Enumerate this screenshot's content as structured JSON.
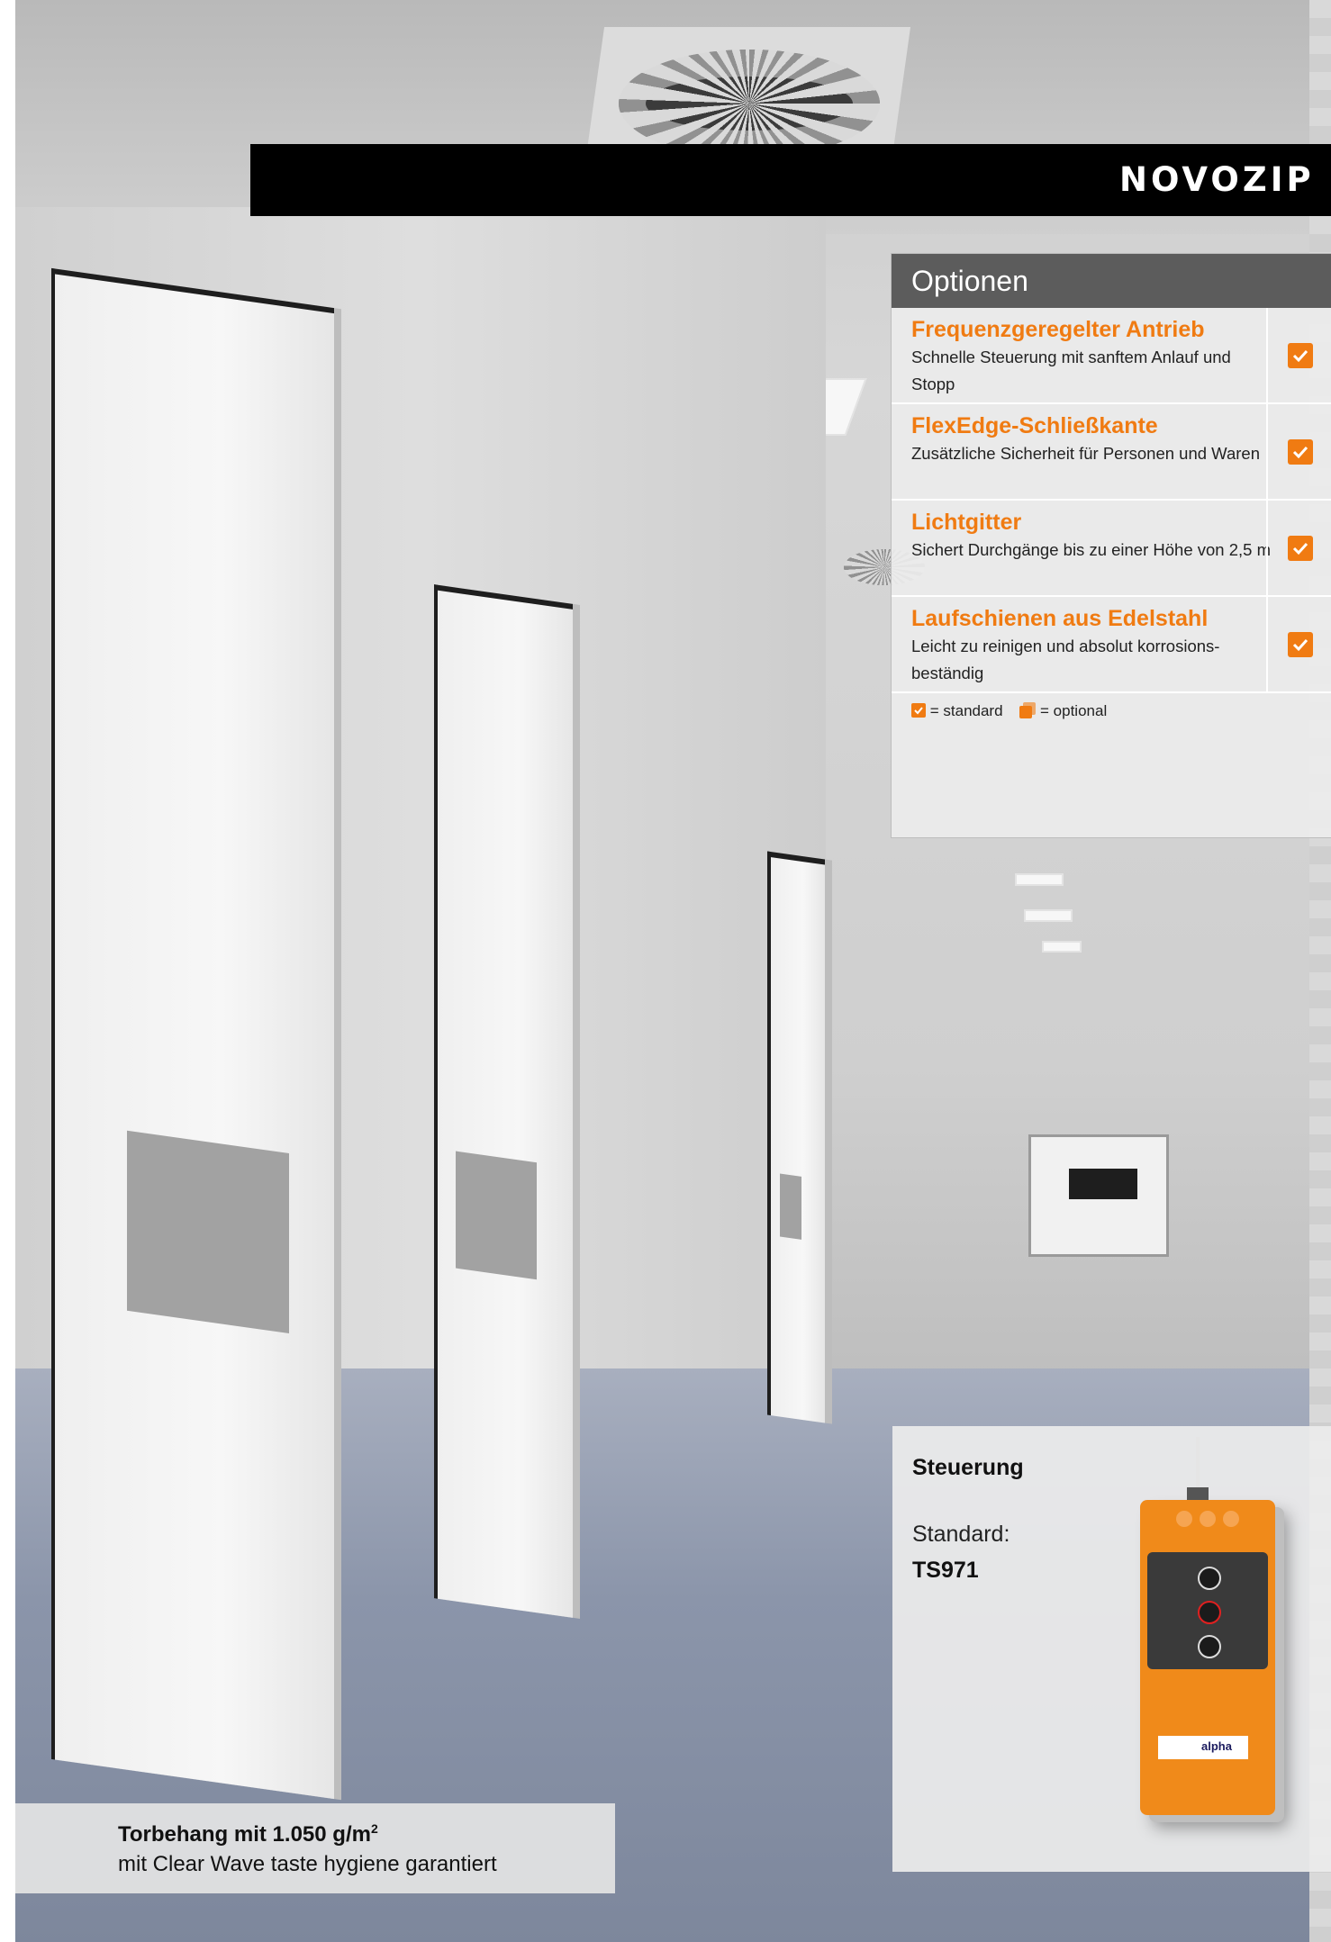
{
  "header": {
    "title": "NOVOZIP"
  },
  "options": {
    "heading": "Optionen",
    "items": [
      {
        "title": "Frequenzgeregelter Antrieb",
        "description": "Schnelle Steuerung mit sanftem Anlauf und Stopp",
        "status": "standard"
      },
      {
        "title": "FlexEdge-Schließkante",
        "description": "Zusätzliche Sicherheit für Personen und Waren",
        "status": "standard"
      },
      {
        "title": "Lichtgitter",
        "description": "Sichert Durchgänge bis zu einer Höhe von 2,5 m",
        "status": "standard"
      },
      {
        "title": "Laufschienen aus Edelstahl",
        "description": "Leicht zu reinigen und absolut korrosions-beständig",
        "status": "standard"
      }
    ],
    "legend": {
      "standard": "= standard",
      "optional": "= optional"
    }
  },
  "control": {
    "title": "Steuerung",
    "label": "Standard:",
    "model": "TS971",
    "device_logo": "alpha"
  },
  "caption": {
    "line1": "Torbehang mit 1.050 g/m",
    "line1_sup": "2",
    "line2": "mit Clear Wave taste hygiene garantiert"
  },
  "colors": {
    "accent": "#f07b12",
    "header_bg": "#000000",
    "options_header_bg": "#5c5c5c"
  }
}
